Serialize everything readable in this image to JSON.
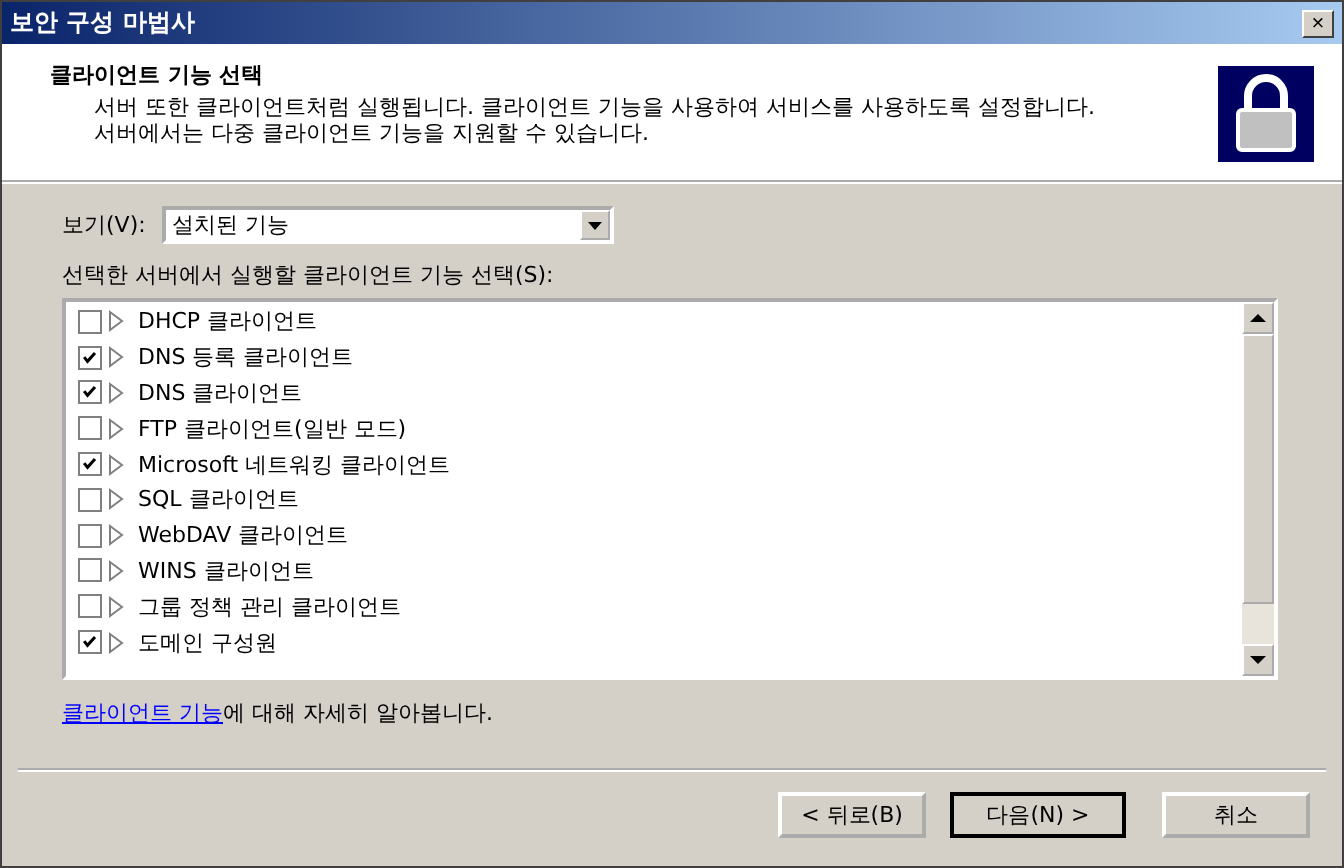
{
  "window": {
    "title": "보안 구성 마법사",
    "close": "×"
  },
  "header": {
    "title": "클라이언트 기능 선택",
    "description": [
      "서버 또한 클라이언트처럼 실행됩니다. 클라이언트 기능을 사용하여 서비스를 사용하도록 설정합니다.",
      "서버에서는 다중 클라이언트 기능을 지원할 수 있습니다."
    ]
  },
  "view": {
    "label": "보기(V):",
    "value": "설치된 기능"
  },
  "list": {
    "label": "선택한 서버에서 실행할 클라이언트 기능 선택(S):",
    "items": [
      {
        "label": "DHCP 클라이언트",
        "checked": false
      },
      {
        "label": "DNS 등록 클라이언트",
        "checked": true
      },
      {
        "label": "DNS 클라이언트",
        "checked": true
      },
      {
        "label": "FTP 클라이언트(일반 모드)",
        "checked": false
      },
      {
        "label": "Microsoft 네트워킹 클라이언트",
        "checked": true
      },
      {
        "label": "SQL 클라이언트",
        "checked": false
      },
      {
        "label": "WebDAV 클라이언트",
        "checked": false
      },
      {
        "label": "WINS 클라이언트",
        "checked": false
      },
      {
        "label": "그룹 정책 관리 클라이언트",
        "checked": false
      },
      {
        "label": "도메인 구성원",
        "checked": true
      }
    ]
  },
  "help": {
    "link": "클라이언트 기능",
    "text": "에 대해 자세히 알아봅니다."
  },
  "buttons": [
    {
      "label": "< 뒤로(B)",
      "default": false
    },
    {
      "label": "다음(N) >",
      "default": true
    },
    {
      "label": "취소",
      "default": false
    }
  ]
}
